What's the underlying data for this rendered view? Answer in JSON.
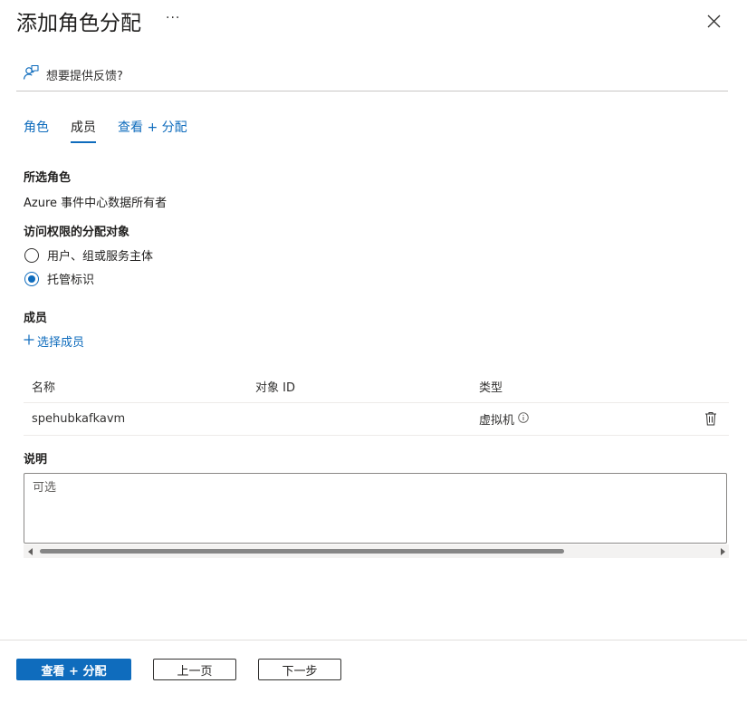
{
  "header": {
    "title": "添加角色分配",
    "more_label": "···"
  },
  "feedback": {
    "label": "想要提供反馈?"
  },
  "tabs": [
    {
      "label": "角色"
    },
    {
      "label": "成员"
    },
    {
      "label": "查看 + 分配"
    }
  ],
  "selected_role": {
    "heading": "所选角色",
    "value": "Azure 事件中心数据所有者"
  },
  "assign_access": {
    "heading": "访问权限的分配对象",
    "options": [
      {
        "label": "用户、组或服务主体",
        "checked": false
      },
      {
        "label": "托管标识",
        "checked": true
      }
    ]
  },
  "members": {
    "heading": "成员",
    "add_label": "选择成员",
    "columns": [
      "名称",
      "对象 ID",
      "类型"
    ],
    "rows": [
      {
        "name": "spehubkafkavm",
        "object_id": "",
        "type": "虚拟机"
      }
    ]
  },
  "description": {
    "heading": "说明",
    "placeholder": "可选"
  },
  "footer": {
    "primary_label": "查看 + 分配",
    "prev_label": "上一页",
    "next_label": "下一步"
  },
  "colors": {
    "accent": "#0f6cbd",
    "text": "#323130"
  }
}
